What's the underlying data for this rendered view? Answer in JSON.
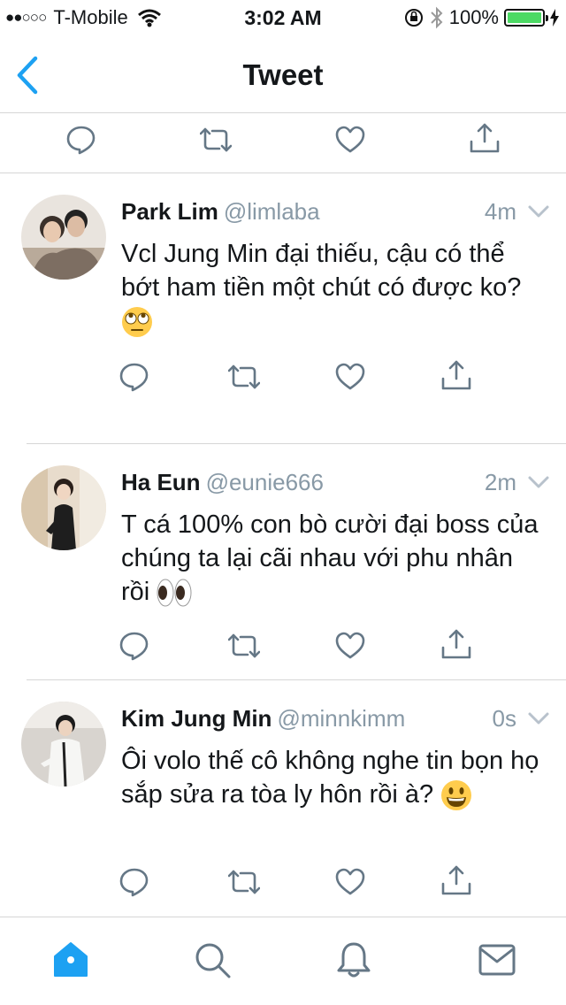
{
  "status_bar": {
    "signal": "●●○○○",
    "carrier": "T-Mobile",
    "time": "3:02 AM",
    "battery": "100%"
  },
  "nav": {
    "title": "Tweet"
  },
  "tweets": [
    {
      "name": "Park Lim",
      "handle": "@limlaba",
      "time": "4m",
      "text": "Vcl Jung Min đại thiếu, cậu có thể bớt ham tiền một chút có được ko?",
      "emoji": "rolling-eyes"
    },
    {
      "name": "Ha Eun",
      "handle": "@eunie666",
      "time": "2m",
      "text": "T cá 100% con bò cười đại boss của chúng ta lại cãi nhau với phu nhân rồi",
      "emoji": "eyes"
    },
    {
      "name": "Kim Jung Min",
      "handle": "@minnkimm",
      "time": "0s",
      "text": "Ôi volo thế cô không nghe tin bọn họ sắp sửa ra tòa ly hôn rồi à?",
      "emoji": "grinning"
    }
  ],
  "colors": {
    "accent": "#1da1f2",
    "muted": "#8899a6",
    "icon": "#657786",
    "text": "#14171a",
    "divider": "#d6d6d6",
    "battery": "#4cd964"
  },
  "tabs": [
    "home-icon",
    "search-icon",
    "notifications-icon",
    "messages-icon"
  ]
}
